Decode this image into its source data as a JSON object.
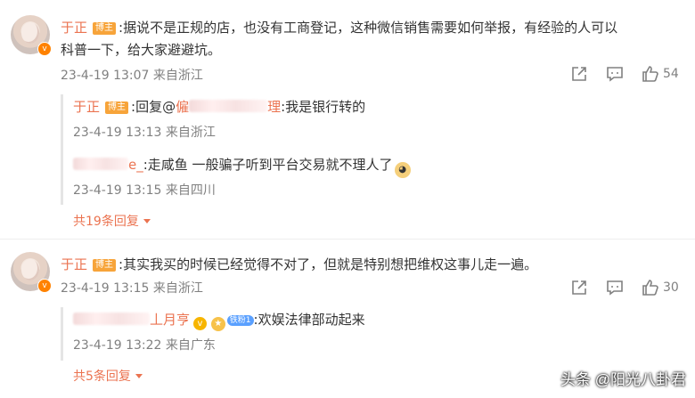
{
  "comments": [
    {
      "user": "于正",
      "badge": "博主",
      "text_line1": ":据说不是正规的店，也没有工商登记，这种微信销售需要如何举报，有经验的人可以",
      "text_line2": "科普一下，给大家避避坑。",
      "meta": "23-4-19 13:07 来自浙江",
      "likes": "54",
      "replies": [
        {
          "user": "于正",
          "badge": "博主",
          "reply_prefix": ":回复@",
          "mention_visible": "僱",
          "mention_tail": "理",
          "text": ":我是银行转的",
          "meta": "23-4-19 13:13 来自浙江"
        },
        {
          "user_tail": "e_",
          "text": ":走咸鱼 一般骗子听到平台交易就不理人了",
          "meta": "23-4-19 13:15 来自四川"
        }
      ],
      "more": "共19条回复"
    },
    {
      "user": "于正",
      "badge": "博主",
      "text_line1": ":其实我买的时候已经觉得不对了，但就是特别想把维权这事儿走一遍。",
      "meta": "23-4-19 13:15 来自浙江",
      "likes": "30",
      "replies": [
        {
          "user_tail": "丄月亨",
          "fan_badge": "铁粉1",
          "text": ":欢娱法律部动起来",
          "meta": "23-4-19 13:22 来自广东"
        }
      ],
      "more": "共5条回复"
    }
  ],
  "watermark": "头条 @阳光八卦君",
  "colors": {
    "username": "#eb7350",
    "meta": "#808080",
    "badge": "#f7a43a"
  },
  "icons": [
    "share-icon",
    "comment-icon",
    "like-icon",
    "dropdown-icon"
  ]
}
